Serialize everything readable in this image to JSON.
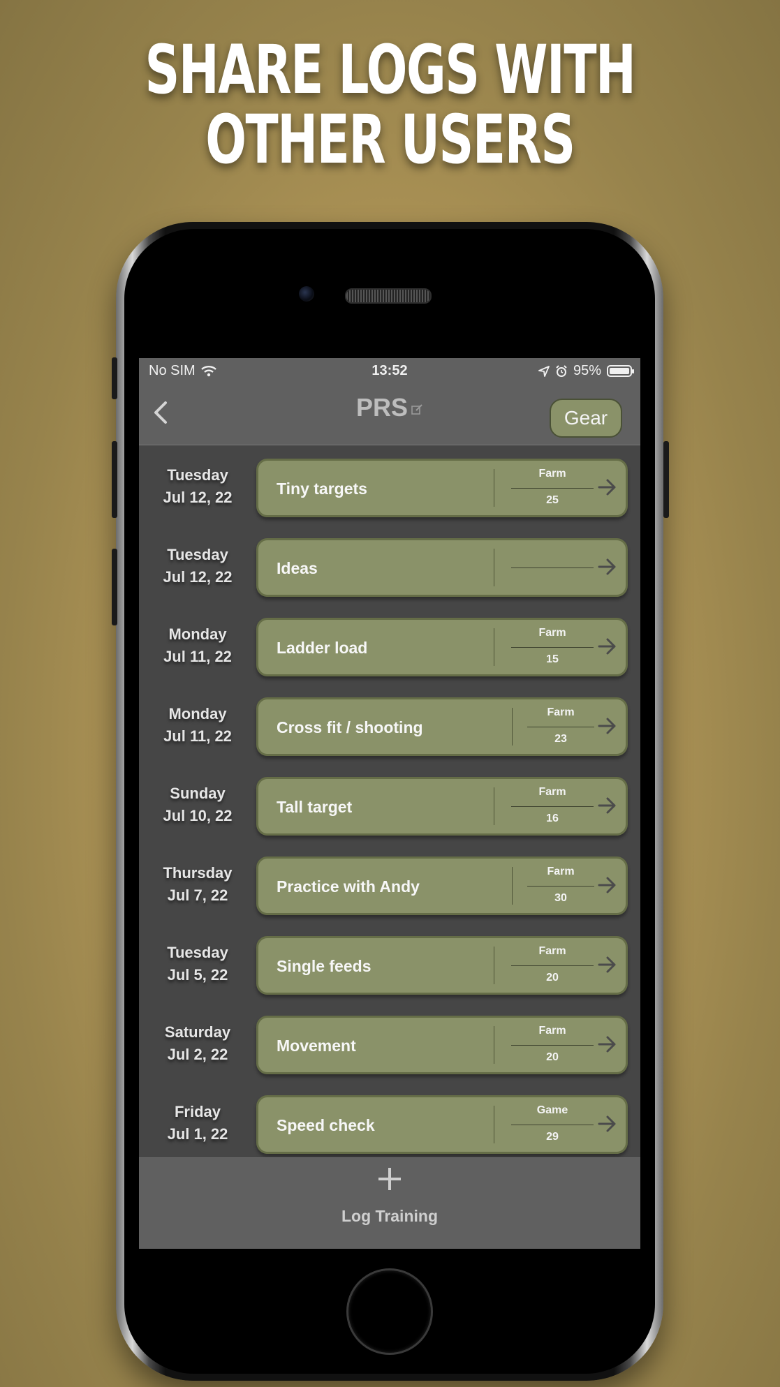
{
  "headline": {
    "line1": "SHARE LOGS WITH",
    "line2": "OTHER USERS"
  },
  "status_bar": {
    "carrier": "No SIM",
    "time": "13:52",
    "battery": "95%"
  },
  "nav": {
    "title": "PRS",
    "gear_label": "Gear"
  },
  "colors": {
    "card": "#8a9269",
    "screen_bg": "#464646",
    "bar_bg": "#606060"
  },
  "entries": [
    {
      "day": "Tuesday",
      "date": "Jul 12, 22",
      "title": "Tiny targets",
      "location": "Farm",
      "count": "25"
    },
    {
      "day": "Tuesday",
      "date": "Jul 12, 22",
      "title": "Ideas",
      "location": "",
      "count": ""
    },
    {
      "day": "Monday",
      "date": "Jul 11, 22",
      "title": "Ladder load",
      "location": "Farm",
      "count": "15"
    },
    {
      "day": "Monday",
      "date": "Jul 11, 22",
      "title": "Cross fit / shooting",
      "location": "Farm",
      "count": "23"
    },
    {
      "day": "Sunday",
      "date": "Jul 10, 22",
      "title": "Tall target",
      "location": "Farm",
      "count": "16"
    },
    {
      "day": "Thursday",
      "date": "Jul 7, 22",
      "title": "Practice with Andy",
      "location": "Farm",
      "count": "30"
    },
    {
      "day": "Tuesday",
      "date": "Jul 5, 22",
      "title": "Single feeds",
      "location": "Farm",
      "count": "20"
    },
    {
      "day": "Saturday",
      "date": "Jul 2, 22",
      "title": "Movement",
      "location": "Farm",
      "count": "20"
    },
    {
      "day": "Friday",
      "date": "Jul 1, 22",
      "title": "Speed check",
      "location": "Game",
      "count": "29"
    }
  ],
  "tabbar": {
    "label": "Log Training"
  }
}
